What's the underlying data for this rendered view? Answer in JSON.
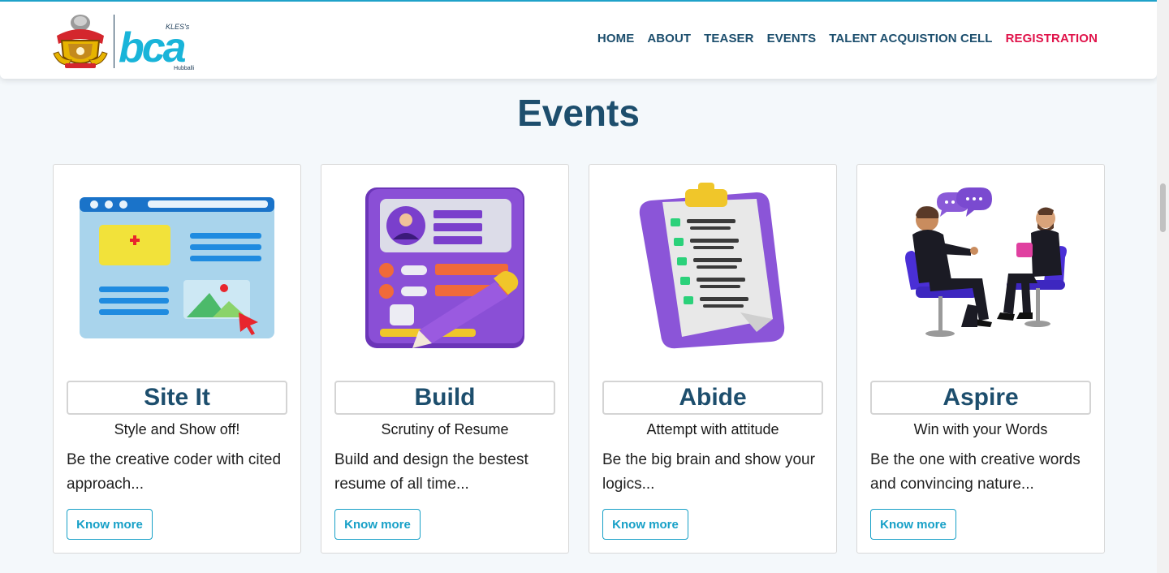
{
  "header": {
    "logo_kles": "KLES's",
    "logo_main": "bca",
    "logo_city": "Hubballi",
    "nav": [
      {
        "label": "HOME"
      },
      {
        "label": "ABOUT"
      },
      {
        "label": "TEASER"
      },
      {
        "label": "EVENTS"
      },
      {
        "label": "TALENT ACQUISTION CELL"
      },
      {
        "label": "REGISTRATION",
        "active": true
      }
    ]
  },
  "events": {
    "title": "Events",
    "cards": [
      {
        "name": "Site It",
        "tagline": "Style and Show off!",
        "desc": "Be the creative coder with cited approach...",
        "button": "Know more",
        "icon": "website-builder-icon"
      },
      {
        "name": "Build",
        "tagline": "Scrutiny of Resume",
        "desc": "Build and design the bestest resume of all time...",
        "button": "Know more",
        "icon": "resume-icon"
      },
      {
        "name": "Abide",
        "tagline": "Attempt with attitude",
        "desc": "Be the big brain and show your logics...",
        "button": "Know more",
        "icon": "clipboard-checklist-icon"
      },
      {
        "name": "Aspire",
        "tagline": "Win with your Words",
        "desc": "Be the one with creative words and convincing nature...",
        "button": "Know more",
        "icon": "interview-icon"
      }
    ]
  },
  "colors": {
    "heading": "#1d4e6d",
    "nav": "#1c4e6d",
    "nav_active": "#e0134a",
    "button": "#17a0c7",
    "background": "#f4f8fb"
  }
}
